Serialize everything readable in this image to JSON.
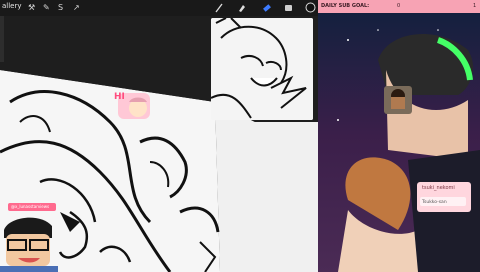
{
  "app": {
    "gallery_label": "allery",
    "toolbar_glyphs": [
      "⚒",
      "✎",
      "S",
      "↗"
    ]
  },
  "sticker": {
    "text": "HI"
  },
  "chat_overlay": {
    "tag": "@x_lunasstarviews"
  },
  "stream": {
    "subgoal": {
      "label": "DAILY SUB GOAL:",
      "count": "0",
      "target": "1"
    },
    "chat": {
      "user": "tsuki_nekomi",
      "message": "Tsukko-san"
    }
  },
  "colors": {
    "subgoal_bar": "#f7a3b4",
    "chat_tag": "#ff6a8e",
    "toolbar_active": "#3d7bff",
    "sky_dark": "#1a1033"
  }
}
